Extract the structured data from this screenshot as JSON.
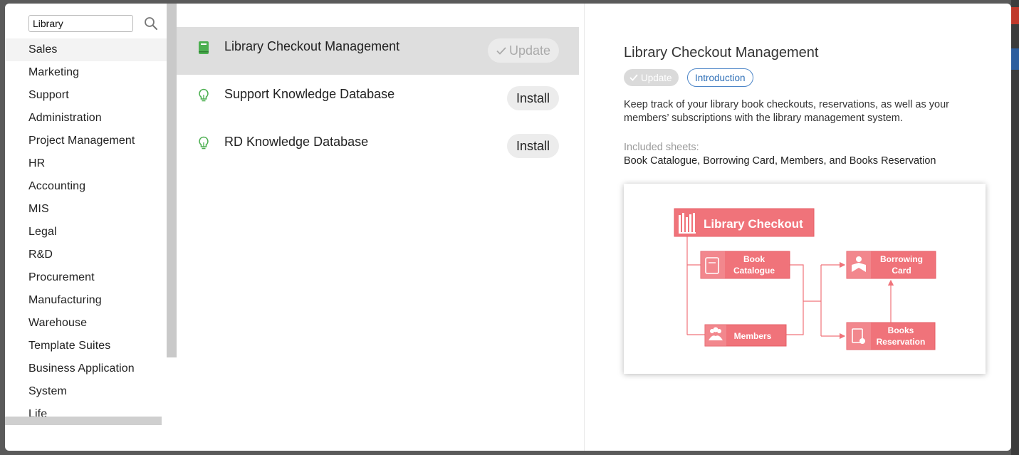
{
  "sidebar": {
    "search": {
      "value": "Library"
    },
    "categories": [
      "Sales",
      "Marketing",
      "Support",
      "Administration",
      "Project Management",
      "HR",
      "Accounting",
      "MIS",
      "Legal",
      "R&D",
      "Procurement",
      "Manufacturing",
      "Warehouse",
      "Template Suites",
      "Business Application",
      "System",
      "Life"
    ],
    "active_index": 0
  },
  "templates": [
    {
      "name": "Library Checkout Management",
      "action": "Update",
      "icon": "book-icon",
      "selected": true
    },
    {
      "name": "Support Knowledge Database",
      "action": "Install",
      "icon": "lightbulb-icon",
      "selected": false
    },
    {
      "name": "RD Knowledge Database",
      "action": "Install",
      "icon": "lightbulb-icon",
      "selected": false
    }
  ],
  "detail": {
    "title": "Library Checkout Management",
    "update_tag": "Update",
    "intro_tag": "Introduction",
    "description": "Keep track of your library book checkouts, reservations, as well as your members’ subscriptions with the library management system.",
    "included_label": "Included sheets:",
    "included_value": "Book Catalogue, Borrowing Card, Members, and Books Reservation",
    "diagram": {
      "header": "Library Checkout",
      "book_catalogue": [
        "Book",
        "Catalogue"
      ],
      "borrowing_card": [
        "Borrowing",
        "Card"
      ],
      "members": "Members",
      "books_reservation": [
        "Books",
        "Reservation"
      ]
    }
  },
  "colors": {
    "diagram_fill": "#f0737a",
    "icon_green": "#4caf50",
    "link_blue": "#2e6fb7"
  }
}
